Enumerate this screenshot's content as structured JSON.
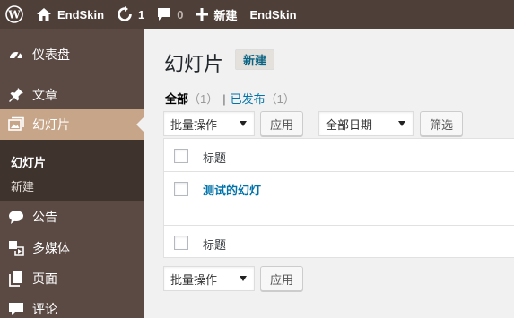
{
  "adminbar": {
    "wp_icon": "wordpress-logo-icon",
    "site_icon": "home-icon",
    "site_name": "EndSkin",
    "updates_icon": "updates-icon",
    "updates_count": "1",
    "comments_icon": "comment-bubble-icon",
    "comments_count": "0",
    "new_icon": "plus-icon",
    "new_label": "新建",
    "theme_label": "EndSkin"
  },
  "sidebar": {
    "items": [
      {
        "label": "仪表盘",
        "icon": "dashboard-icon"
      },
      {
        "label": "文章",
        "icon": "pin-icon"
      },
      {
        "label": "幻灯片",
        "icon": "slides-icon"
      },
      {
        "label": "公告",
        "icon": "speech-bubble-icon"
      },
      {
        "label": "多媒体",
        "icon": "media-icon"
      },
      {
        "label": "页面",
        "icon": "page-icon"
      },
      {
        "label": "评论",
        "icon": "comment-icon"
      }
    ],
    "submenu": [
      {
        "label": "幻灯片"
      },
      {
        "label": "新建"
      }
    ]
  },
  "main": {
    "title": "幻灯片",
    "add_new": "新建",
    "filters": {
      "all_label": "全部",
      "all_count": "（1）",
      "separator": "|",
      "published_label": "已发布",
      "published_count": "（1）"
    },
    "bulk_action_top": "批量操作",
    "apply_top": "应用",
    "date_filter": "全部日期",
    "filter_button": "筛选",
    "table": {
      "header_title": "标题",
      "rows": [
        {
          "title": "测试的幻灯"
        }
      ],
      "footer_title": "标题"
    },
    "bulk_action_bottom": "批量操作",
    "apply_bottom": "应用"
  },
  "colors": {
    "adminbar_bg": "#4e3f39",
    "sidebar_bg": "#5a4a43",
    "active_item": "#c7a589",
    "submenu_bg": "#3f332e",
    "link": "#0073aa",
    "page_bg": "#f1f1f1"
  }
}
